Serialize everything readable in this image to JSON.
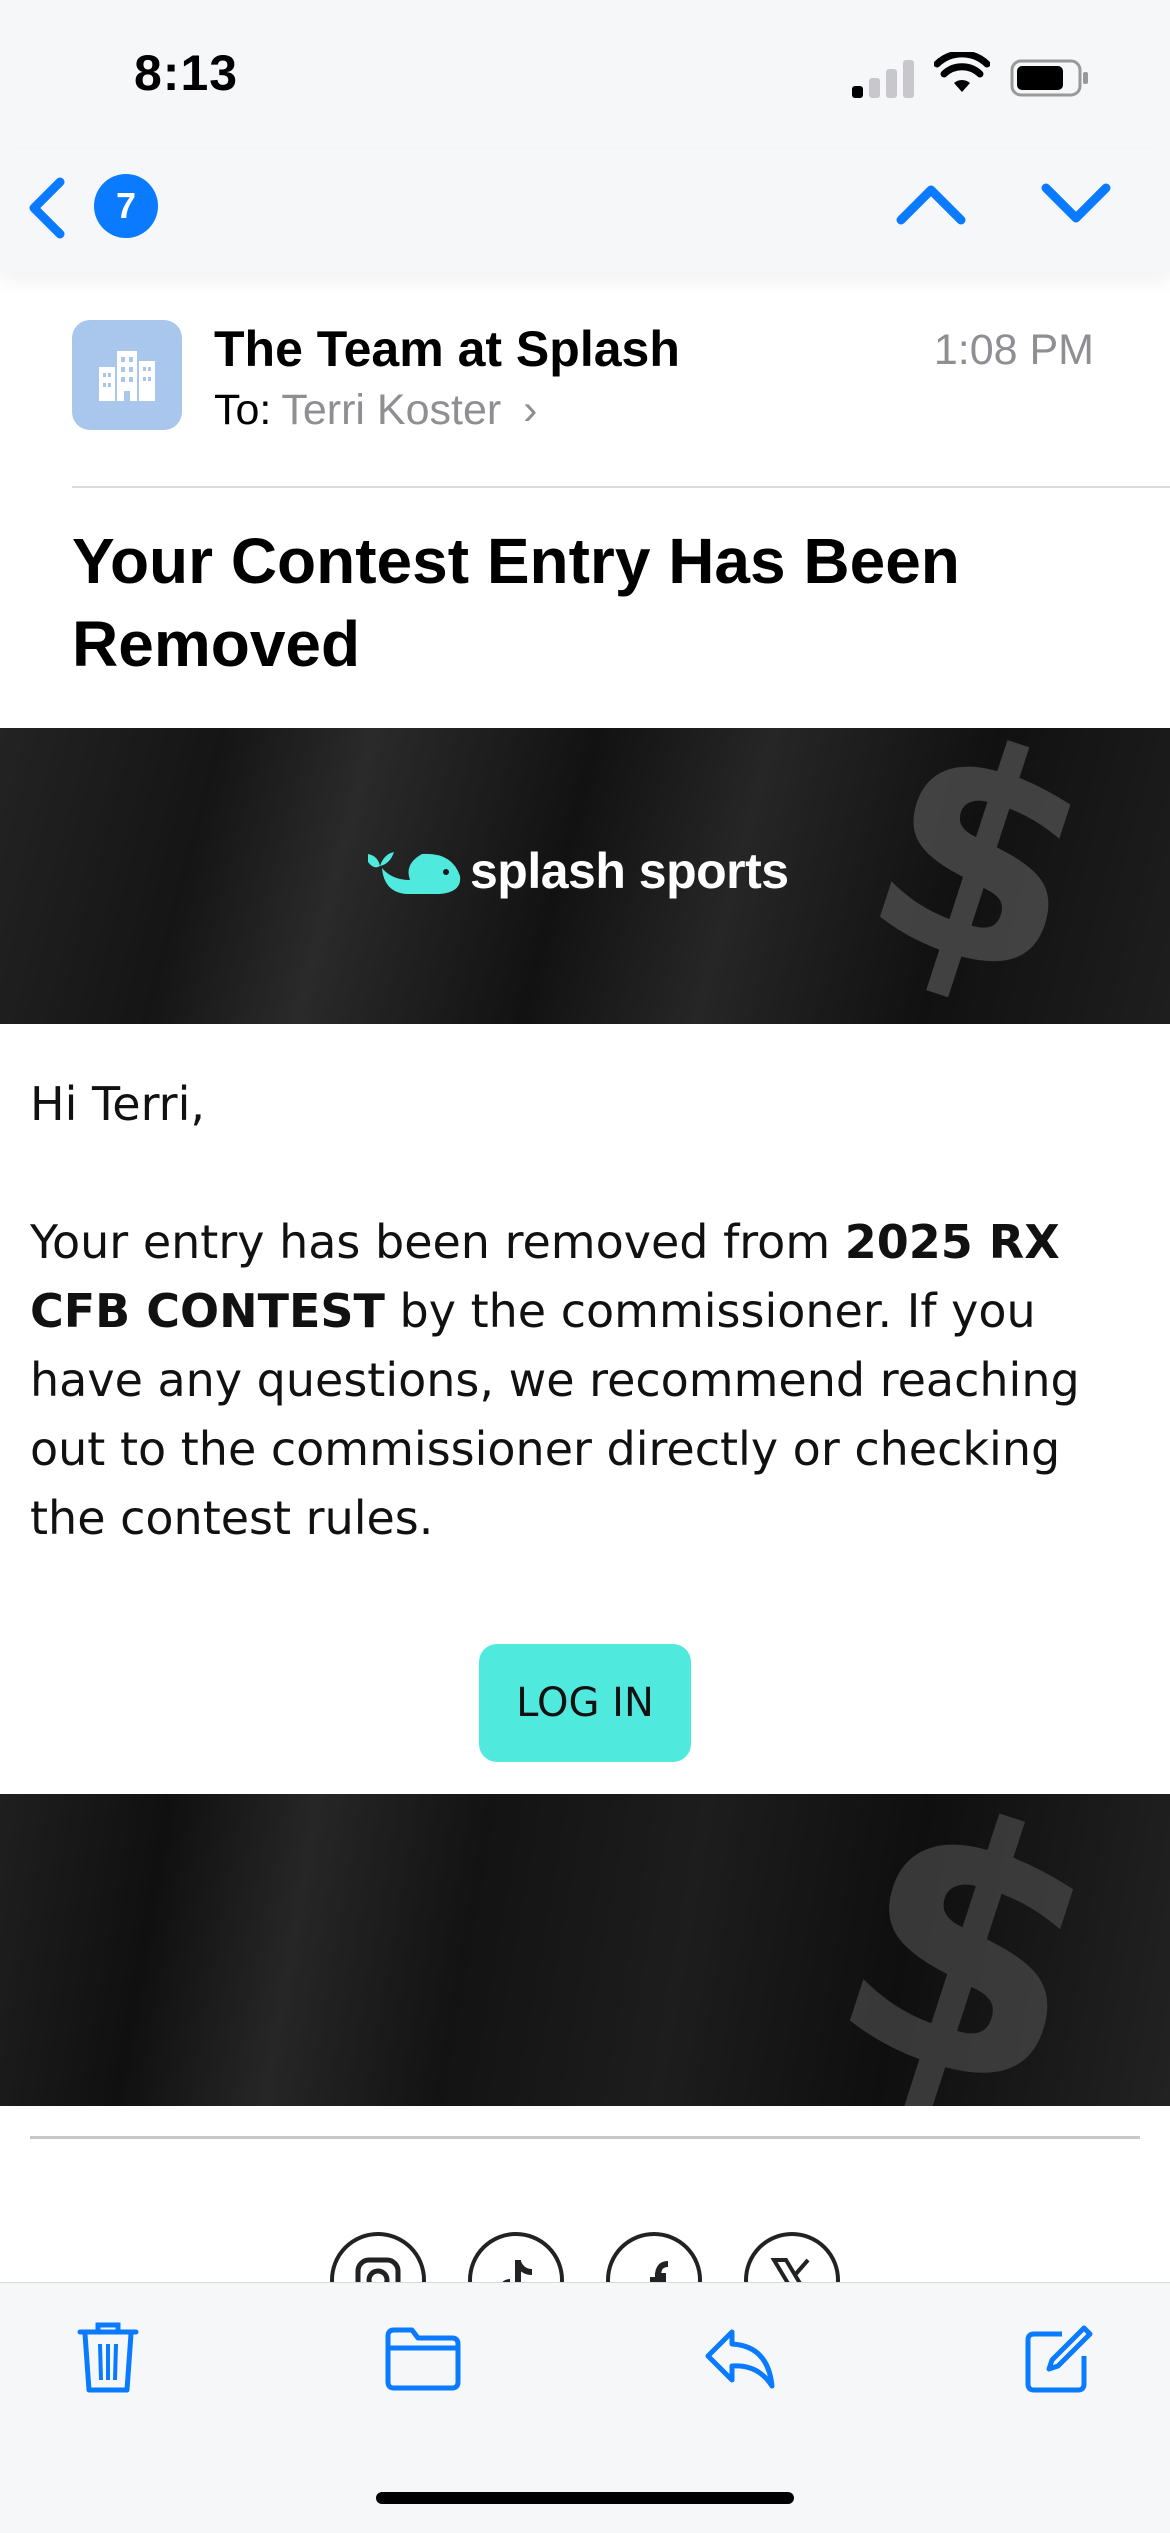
{
  "status_bar": {
    "time": "8:13"
  },
  "nav": {
    "unread_count": "7"
  },
  "email": {
    "sender": "The Team at Splash",
    "to_label": "To:",
    "recipient": "Terri Koster",
    "recipient_chevron": "›",
    "time": "1:08 PM",
    "subject": "Your Contest Entry Has Been Removed"
  },
  "banner": {
    "brand": "splash sports"
  },
  "body": {
    "greeting": "Hi Terri,",
    "message_pre": "Your entry has been removed from ",
    "contest_name": "2025 RX CFB CONTEST",
    "message_post": " by the commissioner. If you have any questions, we recommend reaching out to the commissioner directly or checking the contest rules.",
    "button_label": "LOG IN"
  },
  "icons": {
    "back": "chevron-left-icon",
    "prev": "chevron-up-icon",
    "next": "chevron-down-icon",
    "social": [
      "instagram-icon",
      "tiktok-icon",
      "facebook-icon",
      "x-icon"
    ],
    "toolbar": [
      "trash-icon",
      "folder-icon",
      "reply-icon",
      "compose-icon"
    ]
  },
  "colors": {
    "accent": "#0a7aff",
    "brand_teal": "#4fe9dd",
    "avatar_bg": "#a9c7ec"
  }
}
